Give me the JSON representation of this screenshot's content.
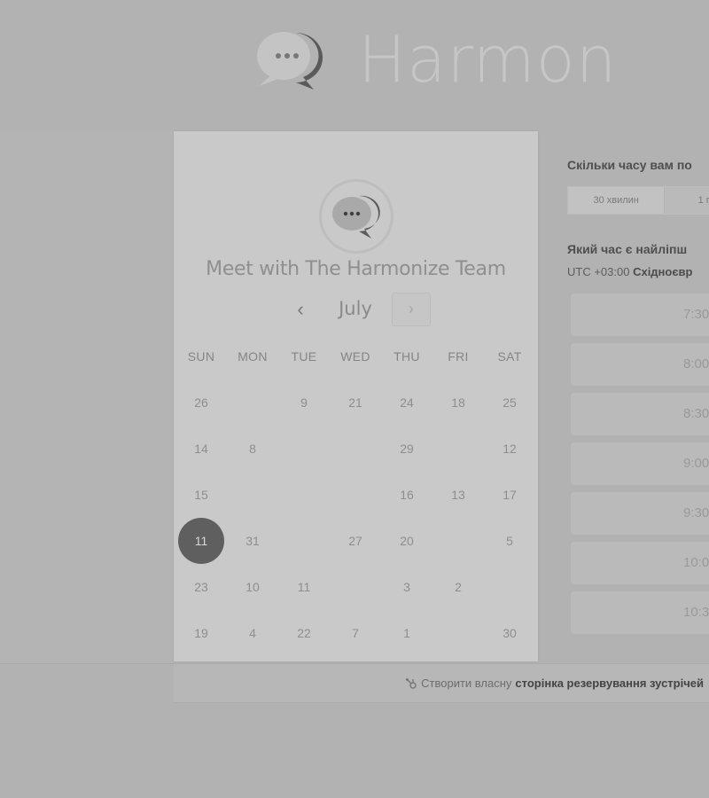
{
  "header": {
    "brand": "Harmon",
    "brand_color": "#c6c6c6"
  },
  "panel": {
    "title": "Meet with The Harmonize Team",
    "month": "July",
    "prev_glyph": "‹",
    "next_glyph": "›",
    "weekdays": [
      "SUN",
      "MON",
      "TUE",
      "WED",
      "THU",
      "FRI",
      "SAT"
    ],
    "weeks": [
      [
        "26",
        "",
        "9",
        "21",
        "24",
        "18",
        "25"
      ],
      [
        "14",
        "8",
        "",
        "",
        "29",
        "",
        "12"
      ],
      [
        "15",
        "",
        "",
        "",
        "16",
        "13",
        "17"
      ],
      [
        "11",
        "31",
        "",
        "27",
        "20",
        "",
        "5"
      ],
      [
        "23",
        "10",
        "11",
        "",
        "3",
        "2",
        ""
      ],
      [
        "19",
        "4",
        "22",
        "7",
        "1",
        "",
        "30"
      ]
    ],
    "selected_day": "11",
    "selected_color": "#5f5f5f"
  },
  "booking": {
    "duration_question": "Скільки часу вам по",
    "duration_options": [
      "30 хвилин",
      "1 г"
    ],
    "time_question": "Який час є найліпш",
    "timezone_offset": "UTC +03:00",
    "timezone_name": "Східноєвр",
    "slots": [
      "7:30",
      "8:00",
      "8:30",
      "9:00",
      "9:30",
      "10:0",
      "10:3"
    ]
  },
  "footer": {
    "prefix": "Створити власну",
    "link": "сторінка резервування зустрічей"
  }
}
